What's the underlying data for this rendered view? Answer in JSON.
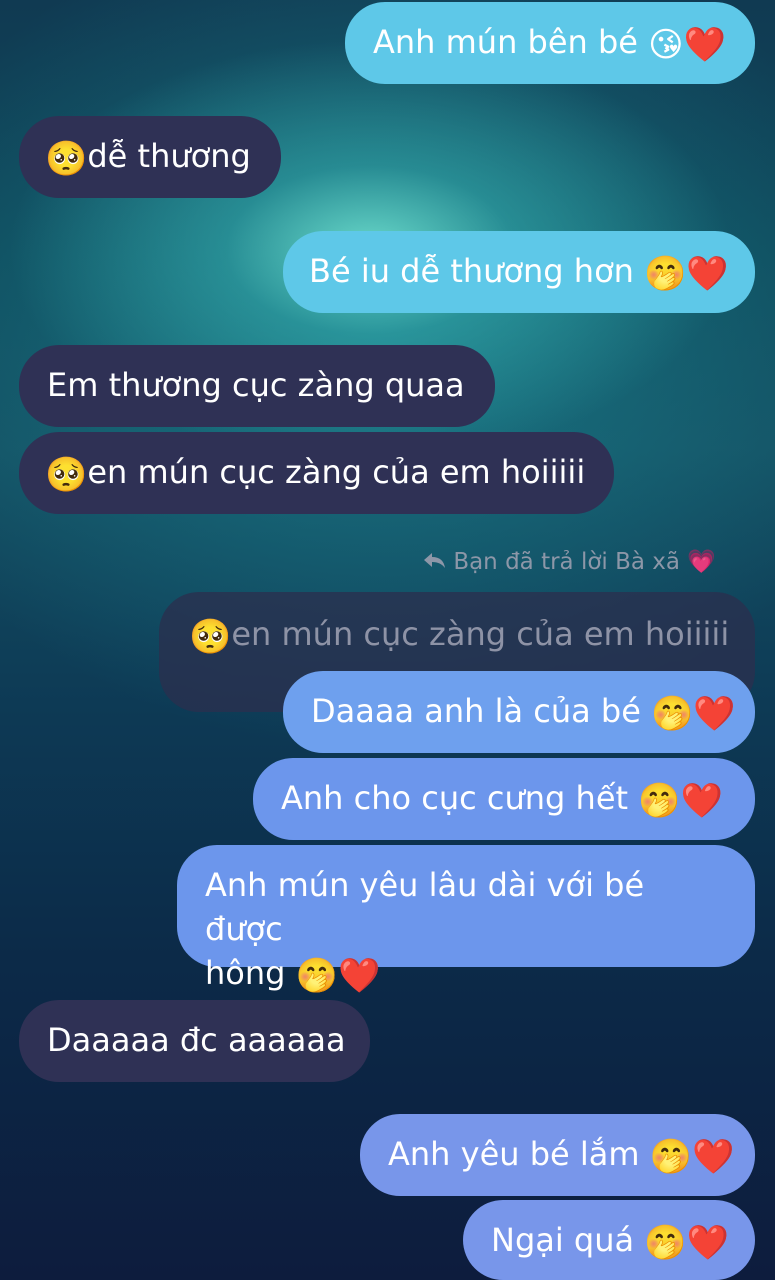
{
  "messages": [
    {
      "text": "Anh mún bên bé",
      "emoji": "😘❤️"
    },
    {
      "text": "dễ thương",
      "emoji": "🥺"
    },
    {
      "text": "Bé iu dễ thương hơn",
      "emoji": "🤭❤️"
    },
    {
      "text": "Em thương cục zàng quaa"
    },
    {
      "text": "en mún cục zàng của em hoiiiii",
      "emoji": "🥺"
    },
    {
      "reply_note": "Bạn đã trả lời Bà xã",
      "reply_heart": "💗",
      "quoted_text": "en mún cục zàng của em hoiiiii",
      "quoted_emoji": "🥺"
    },
    {
      "text": "Daaaa anh là của bé",
      "emoji": "🤭❤️"
    },
    {
      "text": "Anh cho cục cưng hết",
      "emoji": "🤭❤️"
    },
    {
      "text_line1": "Anh mún yêu lâu dài với bé được",
      "text_line2": "hông",
      "emoji": "🤭❤️"
    },
    {
      "text": "Daaaaa đc aaaaaa"
    },
    {
      "text": "Anh yêu bé lắm",
      "emoji": "🤭❤️"
    },
    {
      "text": "Ngại quá",
      "emoji": "🤭❤️"
    }
  ],
  "icons": {
    "reply": "reply-arrow-icon"
  },
  "colors": {
    "incoming": "#2f3155",
    "outgoing_cyan": "#5ec8e8",
    "outgoing_blue": "#6ea0ee"
  }
}
